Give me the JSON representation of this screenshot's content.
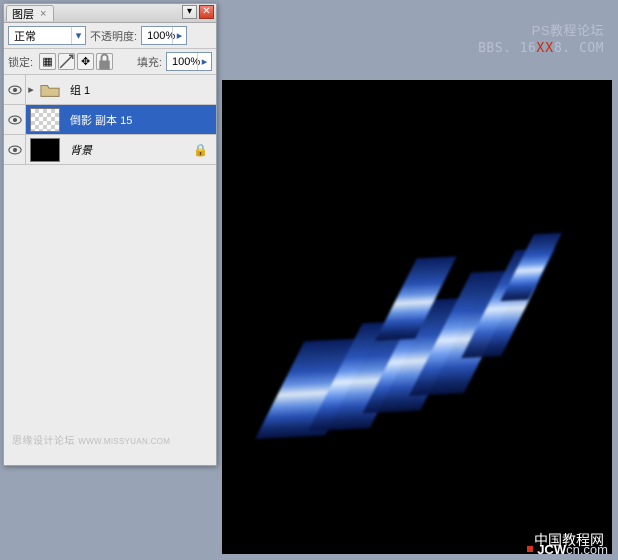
{
  "header_wm": {
    "line1": "PS教程论坛",
    "line2_pre": "BBS. 16",
    "line2_xx": "XX",
    "line2_post": "8. COM"
  },
  "panel": {
    "tab_label": "图层",
    "blend_label": "正常",
    "opacity_label": "不透明度:",
    "opacity_value": "100%",
    "lock_label": "锁定:",
    "fill_label": "填充:",
    "fill_value": "100%",
    "layers": {
      "group": {
        "name": "组 1"
      },
      "selected": {
        "name": "倒影 副本 15"
      },
      "bg": {
        "name": "背景"
      }
    },
    "watermark": {
      "main": "思缘设计论坛",
      "sub": "WWW.MISSYUAN.COM"
    }
  },
  "canvas_wm": "中国教程网",
  "footer": {
    "brand": "JCW",
    "tail": "cn.com"
  }
}
